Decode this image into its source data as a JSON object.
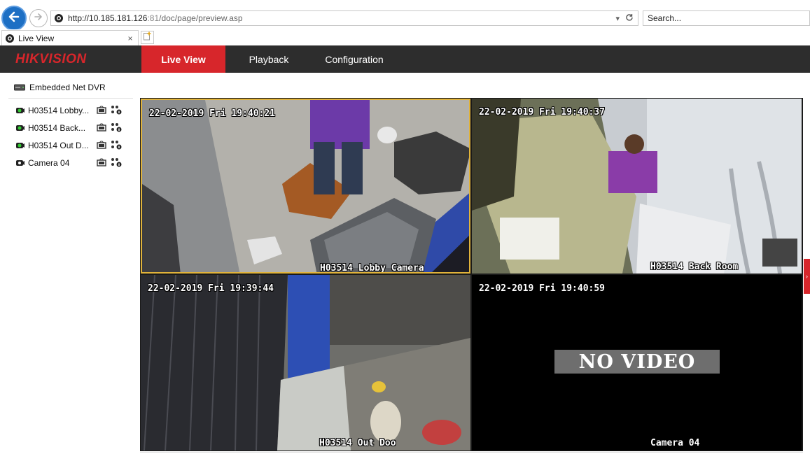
{
  "browser": {
    "url_host": "http://10.185.181.126",
    "url_port": ":81",
    "url_path": "/doc/page/preview.asp",
    "search_placeholder": "Search...",
    "tab_label": "Live View",
    "tab_close": "×",
    "back_icon": "arrow-left-icon",
    "forward_icon": "arrow-right-icon"
  },
  "header": {
    "logo": "HIKVISION",
    "nav": [
      "Live View",
      "Playback",
      "Configuration"
    ],
    "accent": "#d7262b"
  },
  "sidebar": {
    "root_label": "Embedded Net DVR",
    "cameras": [
      {
        "label": "H03514 Lobby Camera",
        "display": "H03514 Lobby..."
      },
      {
        "label": "H03514 Back Room",
        "display": "H03514 Back..."
      },
      {
        "label": "H03514 Out Door",
        "display": "H03514 Out D..."
      },
      {
        "label": "Camera 04",
        "display": "Camera 04"
      }
    ]
  },
  "tiles": [
    {
      "timestamp": "22-02-2019 Fri 19:40:21",
      "name": "H03514 Lobby Camera",
      "signal": "video"
    },
    {
      "timestamp": "22-02-2019 Fri 19:40:37",
      "name": "H03514 Back Room",
      "signal": "video"
    },
    {
      "timestamp": "22-02-2019 Fri 19:39:44",
      "name": "H03514 Out Doo",
      "signal": "video"
    },
    {
      "timestamp": "22-02-2019 Fri 19:40:59",
      "name": "Camera 04",
      "signal": "none",
      "overlay": "NO VIDEO"
    }
  ]
}
